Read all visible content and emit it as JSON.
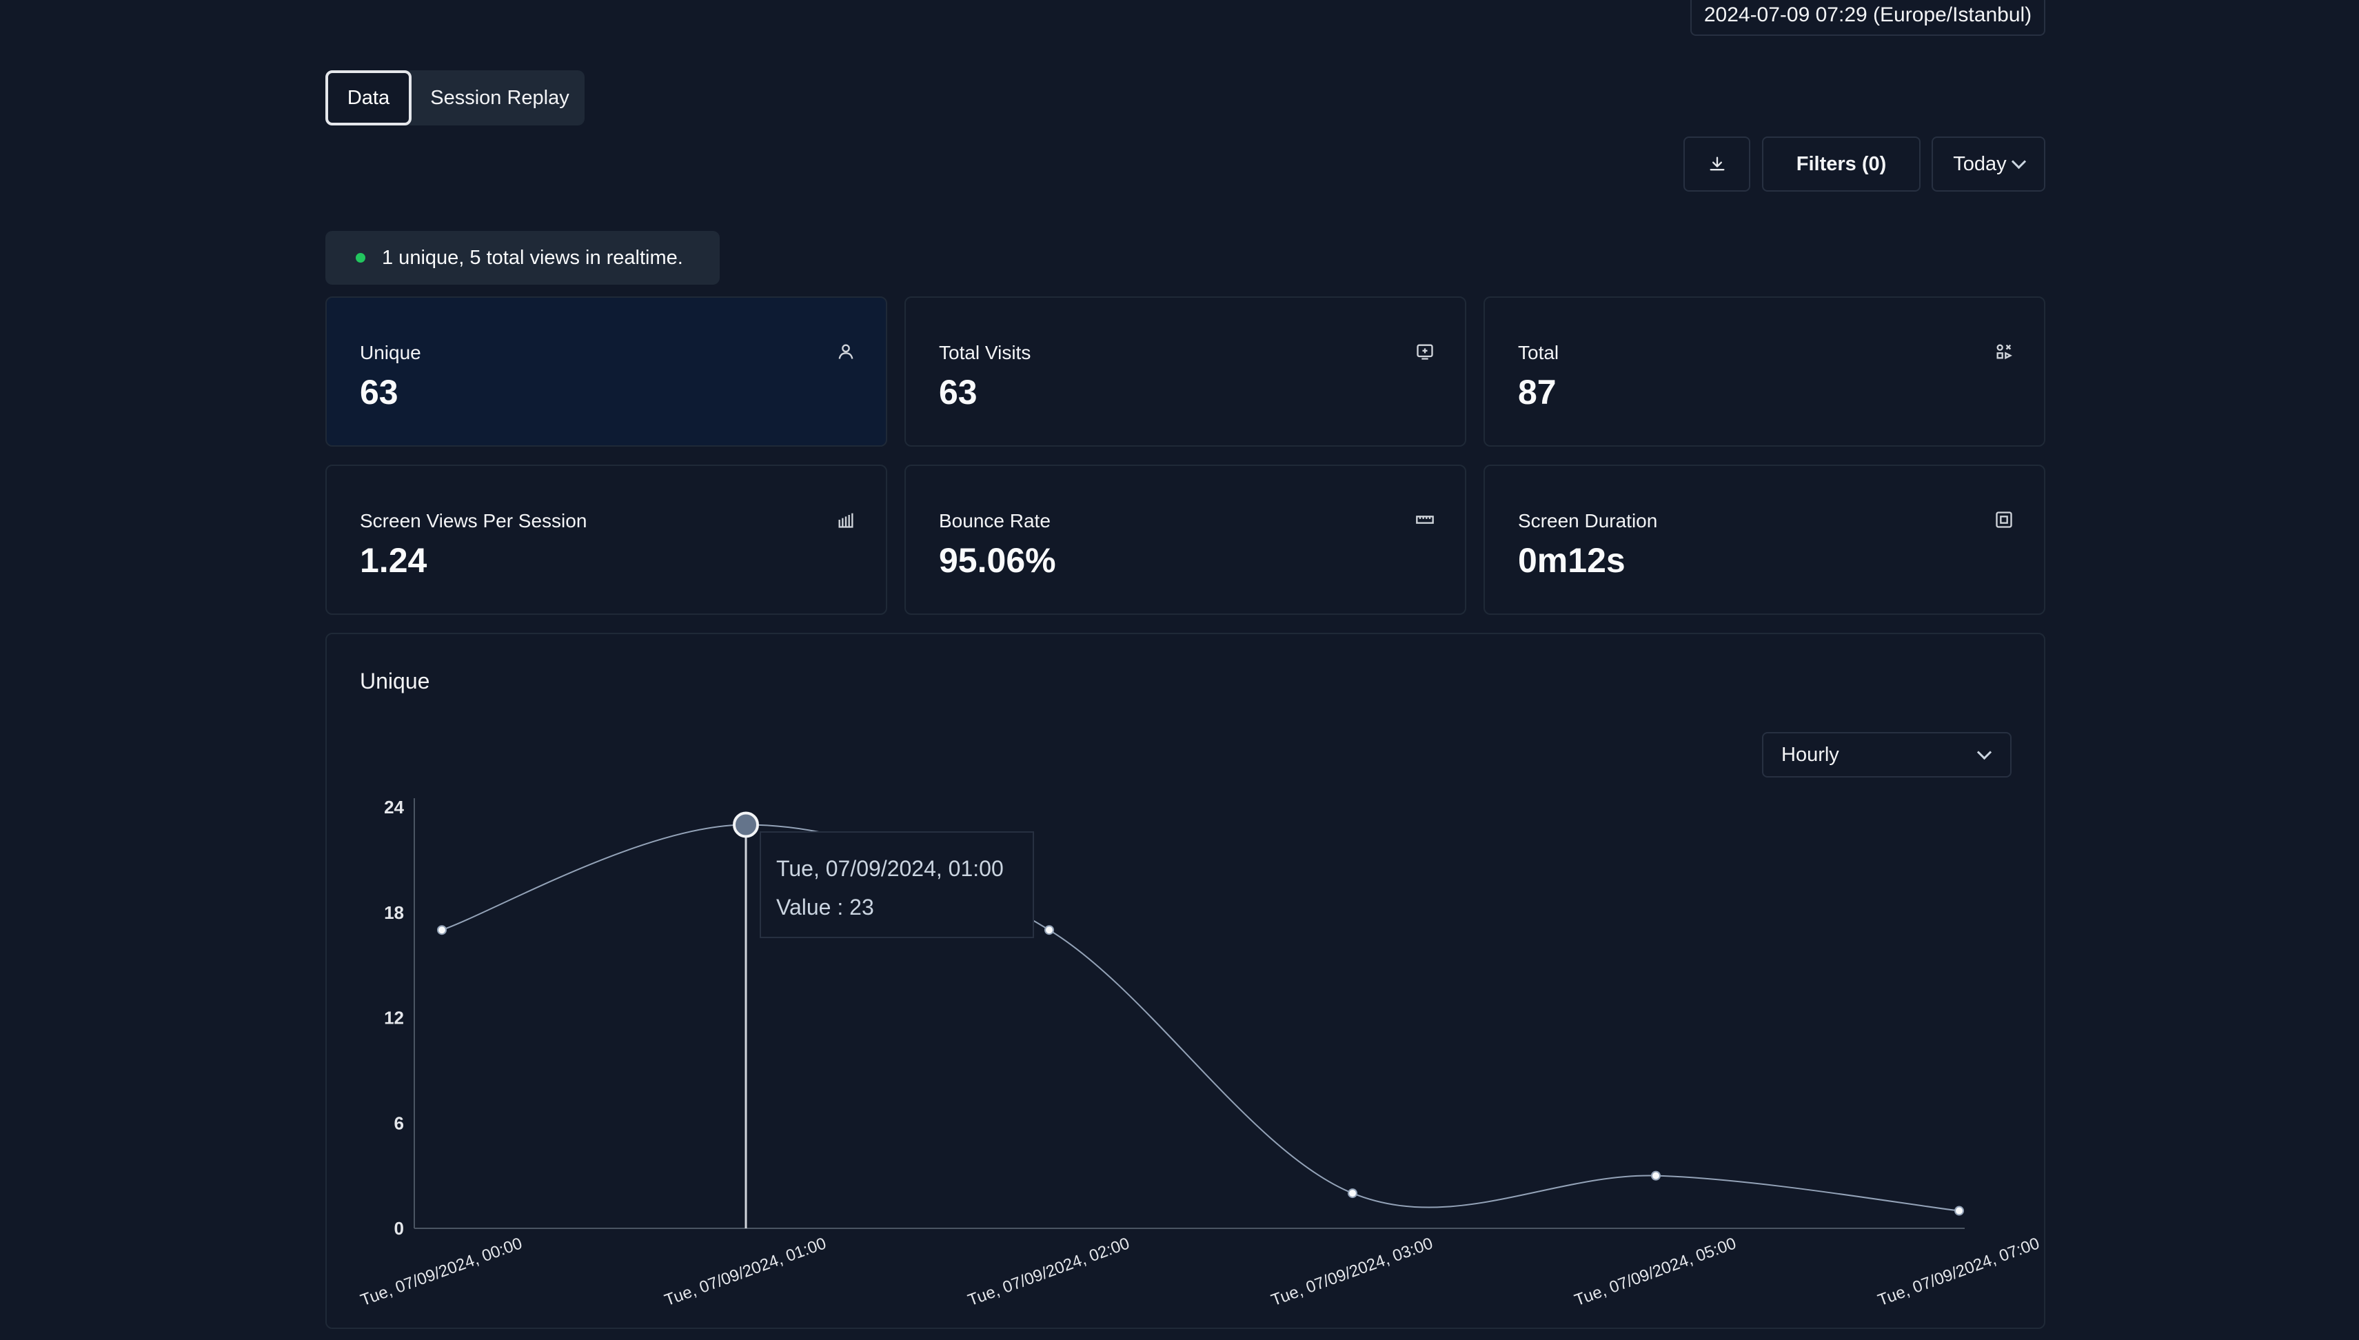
{
  "header": {
    "datetime": "2024-07-09 07:29 (Europe/Istanbul)"
  },
  "tabs": [
    {
      "label": "Data",
      "active": true
    },
    {
      "label": "Session Replay",
      "active": false
    }
  ],
  "toolbar": {
    "download_icon": "download-icon",
    "filters_label": "Filters (0)",
    "range_label": "Today"
  },
  "realtime": {
    "text": "1 unique, 5 total views in realtime.",
    "status_color": "#22c55e"
  },
  "cards": [
    {
      "label": "Unique",
      "value": "63",
      "icon": "user-icon"
    },
    {
      "label": "Total Visits",
      "value": "63",
      "icon": "screen-plus-icon"
    },
    {
      "label": "Total",
      "value": "87",
      "icon": "shapes-icon"
    },
    {
      "label": "Screen Views Per Session",
      "value": "1.24",
      "icon": "bar-chart-icon"
    },
    {
      "label": "Bounce Rate",
      "value": "95.06%",
      "icon": "ruler-icon"
    },
    {
      "label": "Screen Duration",
      "value": "0m12s",
      "icon": "frame-icon"
    }
  ],
  "chart": {
    "title": "Unique",
    "interval": "Hourly",
    "tooltip": {
      "date": "Tue, 07/09/2024, 01:00",
      "value_label": "Value : 23"
    }
  },
  "chart_data": {
    "type": "line",
    "x": [
      "Tue, 07/09/2024, 00:00",
      "Tue, 07/09/2024, 01:00",
      "Tue, 07/09/2024, 02:00",
      "Tue, 07/09/2024, 03:00",
      "Tue, 07/09/2024, 05:00",
      "Tue, 07/09/2024, 07:00"
    ],
    "values": [
      17,
      23,
      17,
      2,
      3,
      1
    ],
    "ylim": [
      0,
      24
    ],
    "yticks": [
      0,
      6,
      12,
      18,
      24
    ],
    "highlight_index": 1,
    "grid": false,
    "line_color": "#94a3b8"
  }
}
